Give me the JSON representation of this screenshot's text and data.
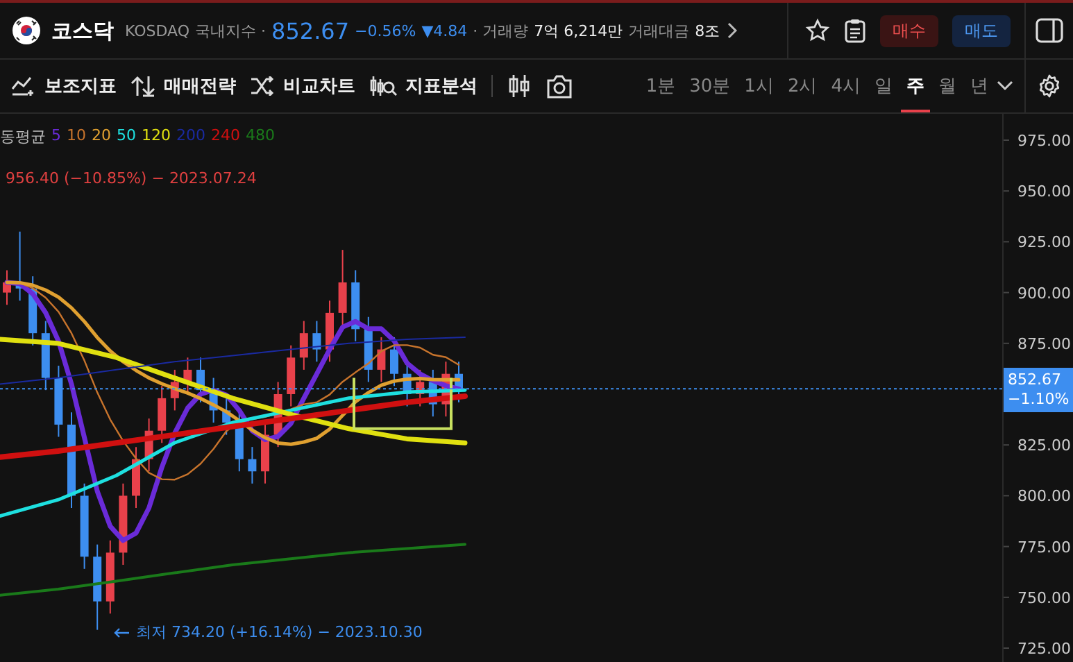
{
  "header": {
    "title": "코스닥",
    "code": "KOSDAQ",
    "market": "국내지수 ·",
    "price": "852.67",
    "change_pct": "−0.56%",
    "change": "▼4.84",
    "volume_label": "· 거래량",
    "volume": "7억 6,214만",
    "amount_label": "거래대금",
    "amount": "8조",
    "buttons": [
      {
        "label": "매수",
        "kind": "buy"
      },
      {
        "label": "매도",
        "kind": "sell"
      }
    ]
  },
  "toolbar": {
    "tools": [
      {
        "label": "보조지표",
        "kind": "indicator"
      },
      {
        "label": "매매전략",
        "kind": "strategy"
      },
      {
        "label": "비교차트",
        "kind": "compare"
      },
      {
        "label": "지표분석",
        "kind": "analysis"
      }
    ],
    "periods": [
      {
        "label": "1분",
        "selected": false
      },
      {
        "label": "30분",
        "selected": false
      },
      {
        "label": "1시",
        "selected": false
      },
      {
        "label": "2시",
        "selected": false
      },
      {
        "label": "4시",
        "selected": false
      },
      {
        "label": "일",
        "selected": false
      },
      {
        "label": "주",
        "selected": true
      },
      {
        "label": "월",
        "selected": false
      },
      {
        "label": "년",
        "selected": false
      }
    ]
  },
  "chart": {
    "legend_label": "동평균",
    "ma_legend": [
      {
        "label": "5",
        "color": "#6a2bd8"
      },
      {
        "label": "10",
        "color": "#c8742c"
      },
      {
        "label": "20",
        "color": "#e0a030"
      },
      {
        "label": "50",
        "color": "#1ee0e0"
      },
      {
        "label": "120",
        "color": "#e0e010"
      },
      {
        "label": "200",
        "color": "#1a2aa0"
      },
      {
        "label": "240",
        "color": "#d01010"
      },
      {
        "label": "480",
        "color": "#1a7a1a"
      }
    ],
    "high_note": "956.40 (−10.85%) − 2023.07.24",
    "low_note": "최저 734.20 (+16.14%) − 2023.10.30",
    "y_axis": [
      "975.00",
      "950.00",
      "925.00",
      "900.00",
      "875.00",
      "825.00",
      "800.00",
      "775.00",
      "750.00",
      "725.00"
    ],
    "last_price": {
      "value": "852.67",
      "change": "−1.10%"
    }
  }
}
